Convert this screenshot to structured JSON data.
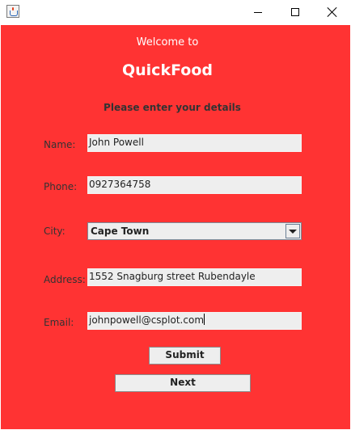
{
  "window": {
    "icon": "java-cup-icon",
    "controls": [
      "minimize-icon",
      "maximize-icon",
      "close-icon"
    ]
  },
  "header": {
    "welcome": "Welcome to",
    "brand": "QuickFood",
    "instruction": "Please enter your details"
  },
  "form": {
    "name": {
      "label": "Name:",
      "value": "John Powell"
    },
    "phone": {
      "label": "Phone:",
      "value": "0927364758"
    },
    "city": {
      "label": "City:",
      "selected": "Cape Town"
    },
    "address": {
      "label": "Address:",
      "value": "1552 Snagburg street Rubendayle"
    },
    "email": {
      "label": "Email:",
      "value": "johnpowell@csplot.com"
    }
  },
  "buttons": {
    "submit": "Submit",
    "next": "Next"
  },
  "colors": {
    "background": "#ff3333",
    "field": "#eeeeee",
    "label_text": "#333333",
    "header_text": "#ffffff"
  }
}
